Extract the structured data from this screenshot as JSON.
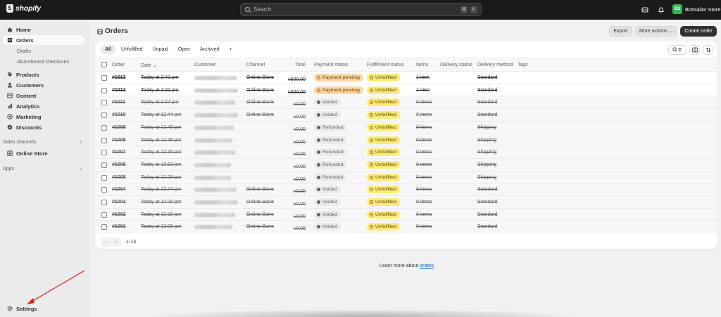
{
  "topbar": {
    "logo_text": "shopify",
    "search_placeholder": "Search",
    "shortcut_keys": [
      "⌘",
      "K"
    ],
    "store_initials": "BS",
    "store_name": "BotSailor Store"
  },
  "sidebar": {
    "items": [
      {
        "label": "Home",
        "icon": "home-icon"
      },
      {
        "label": "Orders",
        "icon": "orders-icon",
        "active": true
      },
      {
        "label": "Drafts",
        "sub": true
      },
      {
        "label": "Abandoned checkouts",
        "sub": true
      },
      {
        "label": "Products",
        "icon": "tag-icon"
      },
      {
        "label": "Customers",
        "icon": "person-icon"
      },
      {
        "label": "Content",
        "icon": "content-icon"
      },
      {
        "label": "Analytics",
        "icon": "chart-icon"
      },
      {
        "label": "Marketing",
        "icon": "target-icon"
      },
      {
        "label": "Discounts",
        "icon": "discount-icon"
      }
    ],
    "sales_channels_label": "Sales channels",
    "online_store_label": "Online Store",
    "apps_label": "Apps",
    "settings_label": "Settings"
  },
  "page": {
    "title": "Orders",
    "export_label": "Export",
    "more_actions_label": "More actions",
    "create_order_label": "Create order"
  },
  "tabs": [
    "All",
    "Unfulfilled",
    "Unpaid",
    "Open",
    "Archived",
    "+"
  ],
  "columns": {
    "order": "Order",
    "date": "Date",
    "customer": "Customer",
    "channel": "Channel",
    "total": "Total",
    "payment": "Payment status",
    "fulfillment": "Fulfillment status",
    "items": "Items",
    "delivery_status": "Delivery status",
    "delivery_method": "Delivery method",
    "tags": "Tags"
  },
  "orders": [
    {
      "order": "#1013",
      "date": "Today at 2:41 pm",
      "channel": "Online Store",
      "total": "৳500.00",
      "payment": "Payment pending",
      "fulfillment": "Unfulfilled",
      "items": "1 item",
      "delivery": "Standard",
      "state": "open"
    },
    {
      "order": "#1012",
      "date": "Today at 2:22 pm",
      "channel": "Online Store",
      "total": "৳500.00",
      "payment": "Payment pending",
      "fulfillment": "Unfulfilled",
      "items": "1 item",
      "delivery": "Standard",
      "state": "open"
    },
    {
      "order": "#1011",
      "date": "Today at 2:17 pm",
      "channel": "Online Store",
      "total": "৳0.00",
      "payment": "Voided",
      "fulfillment": "Unfulfilled",
      "items": "0 items",
      "delivery": "Standard",
      "state": "closed"
    },
    {
      "order": "#1010",
      "date": "Today at 12:44 pm",
      "channel": "Online Store",
      "total": "৳0.00",
      "payment": "Voided",
      "fulfillment": "Unfulfilled",
      "items": "0 items",
      "delivery": "Standard",
      "state": "closed"
    },
    {
      "order": "#1009",
      "date": "Today at 12:40 pm",
      "channel": "",
      "total": "৳0.00",
      "payment": "Refunded",
      "fulfillment": "Unfulfilled",
      "items": "0 items",
      "delivery": "Shipping",
      "state": "closed"
    },
    {
      "order": "#1008",
      "date": "Today at 12:36 pm",
      "channel": "",
      "total": "৳0.00",
      "payment": "Refunded",
      "fulfillment": "Unfulfilled",
      "items": "0 items",
      "delivery": "Shipping",
      "state": "closed"
    },
    {
      "order": "#1007",
      "date": "Today at 12:35 pm",
      "channel": "",
      "total": "৳0.00",
      "payment": "Refunded",
      "fulfillment": "Unfulfilled",
      "items": "0 items",
      "delivery": "Shipping",
      "state": "closed"
    },
    {
      "order": "#1006",
      "date": "Today at 12:33 pm",
      "channel": "",
      "total": "৳0.00",
      "payment": "Refunded",
      "fulfillment": "Unfulfilled",
      "items": "0 items",
      "delivery": "Shipping",
      "state": "closed"
    },
    {
      "order": "#1005",
      "date": "Today at 12:28 pm",
      "channel": "",
      "total": "৳0.00",
      "payment": "Refunded",
      "fulfillment": "Unfulfilled",
      "items": "0 items",
      "delivery": "Shipping",
      "state": "closed"
    },
    {
      "order": "#1004",
      "date": "Today at 12:24 pm",
      "channel": "Online Store",
      "total": "৳0.00",
      "payment": "Voided",
      "fulfillment": "Unfulfilled",
      "items": "0 items",
      "delivery": "Standard",
      "state": "closed"
    },
    {
      "order": "#1003",
      "date": "Today at 12:16 pm",
      "channel": "Online Store",
      "total": "৳0.00",
      "payment": "Voided",
      "fulfillment": "Unfulfilled",
      "items": "0 items",
      "delivery": "Standard",
      "state": "closed"
    },
    {
      "order": "#1002",
      "date": "Today at 12:10 pm",
      "channel": "Online Store",
      "total": "৳0.00",
      "payment": "Voided",
      "fulfillment": "Unfulfilled",
      "items": "0 items",
      "delivery": "Standard",
      "state": "closed"
    },
    {
      "order": "#1001",
      "date": "Today at 12:05 pm",
      "channel": "Online Store",
      "total": "৳0.00",
      "payment": "Voided",
      "fulfillment": "Unfulfilled",
      "items": "0 items",
      "delivery": "Standard",
      "state": "closed"
    }
  ],
  "pagination": {
    "label": "1-13"
  },
  "footer": {
    "learn_text": "Learn more about",
    "learn_link": "orders"
  },
  "colors": {
    "topbar": "#1a1a1a",
    "sidebar": "#ebebeb",
    "primary_button": "#303030",
    "payment_pending": "#ffd6a4",
    "unfulfilled": "#ffeb78",
    "link": "#005bd3",
    "annotation_arrow": "#e0201b"
  }
}
